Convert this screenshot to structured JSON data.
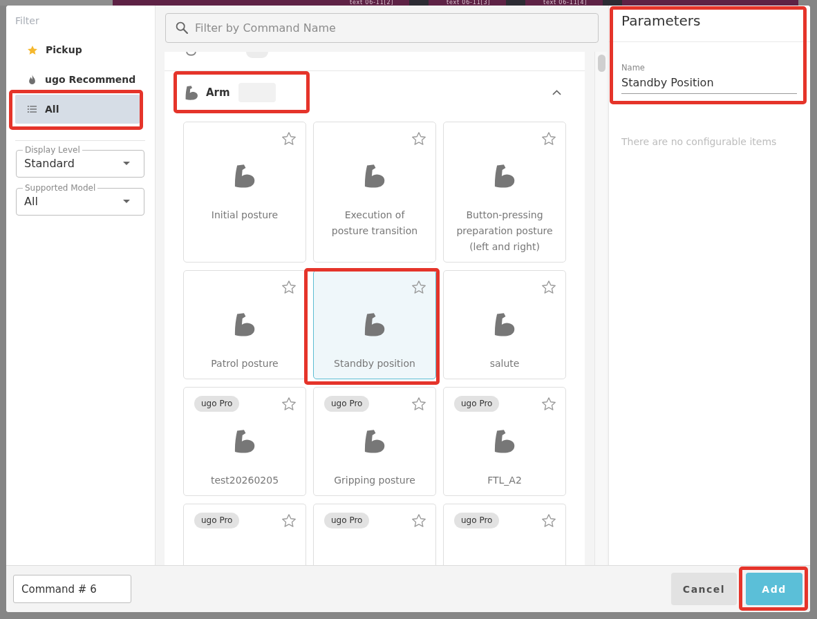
{
  "backdrop": {
    "tabs": [
      "text 06-11[2]",
      "text 06-11[3]",
      "text 06-11[4]"
    ]
  },
  "filter": {
    "title": "Filter",
    "items": [
      {
        "kind": "favorites",
        "label": "Pickup",
        "selected": false,
        "annotated": false
      },
      {
        "kind": "recommended",
        "label": "ugo Recommend",
        "selected": false,
        "annotated": false
      },
      {
        "kind": "all",
        "label": "All",
        "selected": true,
        "annotated": true
      }
    ],
    "dropdowns": [
      {
        "label": "Display Level",
        "value": "Standard"
      },
      {
        "label": "Supported Model",
        "value": "All"
      }
    ]
  },
  "search": {
    "placeholder": "Filter by Command Name"
  },
  "category": {
    "title": "Arm",
    "expanded": true,
    "annotated": true,
    "commands": [
      {
        "label": "Initial posture",
        "favorite": false,
        "selected": false,
        "annotated": false
      },
      {
        "label": "Execution of posture transition",
        "favorite": false,
        "selected": false,
        "annotated": false
      },
      {
        "label": "Button-pressing preparation posture (left and right)",
        "favorite": false,
        "selected": false,
        "annotated": false
      },
      {
        "label": "Patrol posture",
        "favorite": false,
        "selected": false,
        "annotated": false
      },
      {
        "label": "Standby position",
        "favorite": false,
        "selected": true,
        "annotated": true
      },
      {
        "label": "salute",
        "favorite": false,
        "selected": false,
        "annotated": false
      },
      {
        "label": "test20260205",
        "badge": "ugo Pro",
        "favorite": false,
        "selected": false,
        "annotated": false
      },
      {
        "label": "Gripping posture",
        "badge": "ugo Pro",
        "favorite": false,
        "selected": false,
        "annotated": false
      },
      {
        "label": "FTL_A2",
        "badge": "ugo Pro",
        "favorite": false,
        "selected": false,
        "annotated": false
      },
      {
        "badge": "ugo Pro",
        "favorite": false,
        "selected": false,
        "annotated": false
      },
      {
        "badge": "ugo Pro",
        "favorite": false,
        "selected": false,
        "annotated": false
      },
      {
        "badge": "ugo Pro",
        "favorite": false,
        "selected": false,
        "annotated": false
      }
    ]
  },
  "parameters": {
    "title": "Parameters",
    "annotated": true,
    "name_field": {
      "label": "Name",
      "value": "Standby Position"
    },
    "empty_message": "There are no configurable items"
  },
  "footer": {
    "command_name": "Command # 6",
    "buttons": [
      {
        "kind": "secondary",
        "label": "Cancel",
        "annotated": false
      },
      {
        "kind": "primary",
        "label": "Add",
        "annotated": true
      }
    ]
  }
}
